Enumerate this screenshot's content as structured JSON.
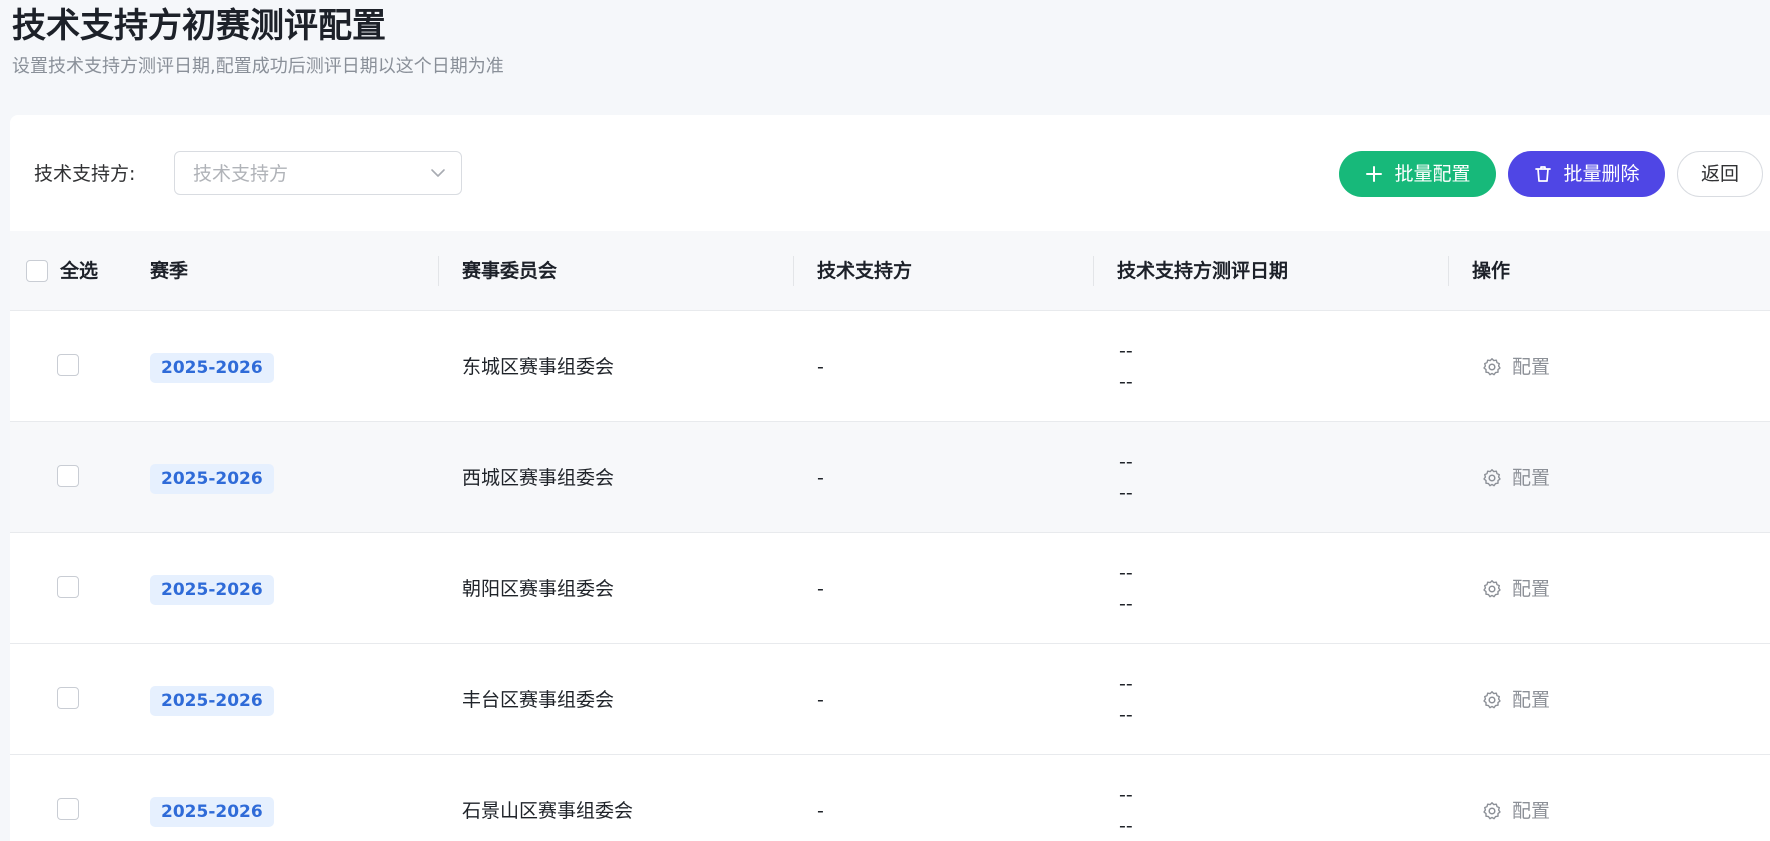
{
  "header": {
    "title": "技术支持方初赛测评配置",
    "subtitle": "设置技术支持方测评日期,配置成功后测评日期以这个日期为准"
  },
  "filter": {
    "label": "技术支持方:",
    "placeholder": "技术支持方"
  },
  "toolbar": {
    "batch_config_label": "批量配置",
    "batch_delete_label": "批量删除",
    "back_label": "返回"
  },
  "colors": {
    "batch_config": "#17b97a",
    "batch_delete": "#4f46e5",
    "season_tag_text": "#2f6bd8",
    "season_tag_bg": "#e6f0fe"
  },
  "table": {
    "select_all_label": "全选",
    "columns": [
      "赛季",
      "赛事委员会",
      "技术支持方",
      "技术支持方测评日期",
      "操作"
    ],
    "rows": [
      {
        "season": "2025-2026",
        "committee": "东城区赛事组委会",
        "tech_support": "-",
        "date_line1": "--",
        "date_line2": "--",
        "action": "配置"
      },
      {
        "season": "2025-2026",
        "committee": "西城区赛事组委会",
        "tech_support": "-",
        "date_line1": "--",
        "date_line2": "--",
        "action": "配置"
      },
      {
        "season": "2025-2026",
        "committee": "朝阳区赛事组委会",
        "tech_support": "-",
        "date_line1": "--",
        "date_line2": "--",
        "action": "配置"
      },
      {
        "season": "2025-2026",
        "committee": "丰台区赛事组委会",
        "tech_support": "-",
        "date_line1": "--",
        "date_line2": "--",
        "action": "配置"
      },
      {
        "season": "2025-2026",
        "committee": "石景山区赛事组委会",
        "tech_support": "-",
        "date_line1": "--",
        "date_line2": "--",
        "action": "配置"
      }
    ]
  },
  "icons": {
    "batch_config": "plus-icon",
    "batch_delete": "trash-icon",
    "select": "chevron-down-icon",
    "row_action": "gear-icon"
  }
}
